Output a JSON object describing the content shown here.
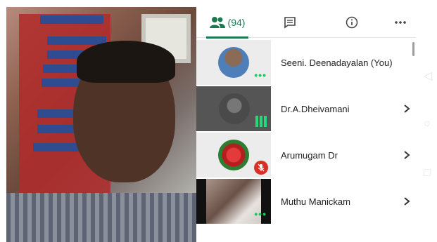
{
  "panel": {
    "tabs": [
      {
        "name": "people",
        "count": "(94)",
        "icon": "people-icon"
      },
      {
        "name": "chat",
        "icon": "chat-icon"
      },
      {
        "name": "info",
        "icon": "info-icon"
      },
      {
        "name": "more",
        "icon": "more-icon"
      }
    ],
    "participants": [
      {
        "name": "Seeni. Deenadayalan (You)",
        "status": "more-dots"
      },
      {
        "name": "Dr.A.Dheivamani",
        "status": "speaking"
      },
      {
        "name": "Arumugam Dr",
        "status": "muted"
      },
      {
        "name": "Muthu Manickam",
        "status": "more-dots"
      }
    ]
  },
  "colors": {
    "accent": "#1a7a4f",
    "speaking": "#2bd67b",
    "muted": "#d93025"
  }
}
